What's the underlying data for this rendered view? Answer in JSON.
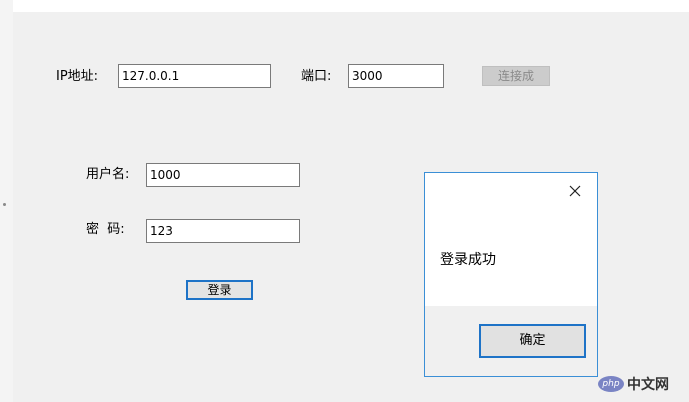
{
  "form": {
    "ip_label": "IP地址:",
    "ip_value": "127.0.0.1",
    "port_label": "端口:",
    "port_value": "3000",
    "connect_label": "连接成",
    "username_label": "用户名:",
    "username_value": "1000",
    "password_label": "密  码:",
    "password_value": "123",
    "login_label": "登录"
  },
  "dialog": {
    "message": "登录成功",
    "ok_label": "确定",
    "close_icon": "close-icon"
  },
  "watermark": {
    "logo_text": "php",
    "site_text": "中文网"
  },
  "colors": {
    "window_bg": "#f0f0f0",
    "dialog_border": "#3b8fd6",
    "focus_blue": "#1e73c7",
    "disabled_text": "#8a8a8a"
  }
}
